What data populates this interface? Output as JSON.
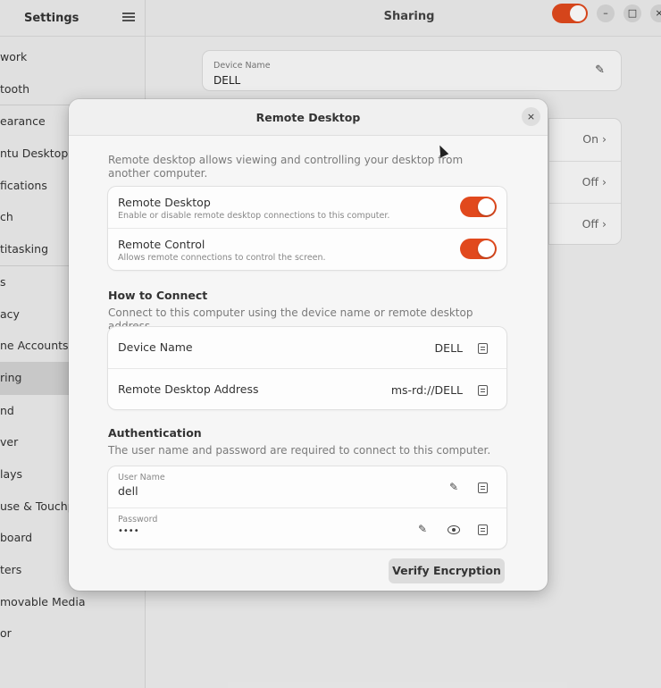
{
  "sidebar": {
    "title": "Settings",
    "items": [
      {
        "label": "work"
      },
      {
        "label": "tooth"
      },
      {
        "label": "earance"
      },
      {
        "label": "ntu Desktop"
      },
      {
        "label": "fications"
      },
      {
        "label": "ch"
      },
      {
        "label": "titasking"
      },
      {
        "label": "s"
      },
      {
        "label": "acy"
      },
      {
        "label": "ne Accounts"
      },
      {
        "label": "ring"
      },
      {
        "label": "nd"
      },
      {
        "label": "ver"
      },
      {
        "label": "lays"
      },
      {
        "label": "use & Touchpad"
      },
      {
        "label": "board"
      },
      {
        "label": "ters"
      },
      {
        "label": "movable Media"
      },
      {
        "label": "or"
      }
    ]
  },
  "header": {
    "title": "Sharing",
    "sharing_enabled": true,
    "minimize": "–",
    "maximize": "□",
    "close": "×"
  },
  "background": {
    "device_name_label": "Device Name",
    "device_name_value": "DELL",
    "rows": [
      {
        "state": "On ›"
      },
      {
        "state": "Off ›"
      },
      {
        "state": "Off ›"
      }
    ]
  },
  "dialog": {
    "title": "Remote Desktop",
    "close": "×",
    "description": "Remote desktop allows viewing and controlling your desktop from another computer.",
    "toggles": [
      {
        "title": "Remote Desktop",
        "subtitle": "Enable or disable remote desktop connections to this computer.",
        "on": true
      },
      {
        "title": "Remote Control",
        "subtitle": "Allows remote connections to control the screen.",
        "on": true
      }
    ],
    "connect": {
      "heading": "How to Connect",
      "description": "Connect to this computer using the device name or remote desktop address.",
      "rows": [
        {
          "label": "Device Name",
          "value": "DELL"
        },
        {
          "label": "Remote Desktop Address",
          "value": "ms-rd://DELL"
        }
      ]
    },
    "auth": {
      "heading": "Authentication",
      "description": "The user name and password are required to connect to this computer.",
      "username_label": "User Name",
      "username_value": "dell",
      "password_label": "Password",
      "password_value": "••••"
    },
    "verify_button": "Verify Encryption"
  },
  "colors": {
    "accent": "#e1491d"
  }
}
